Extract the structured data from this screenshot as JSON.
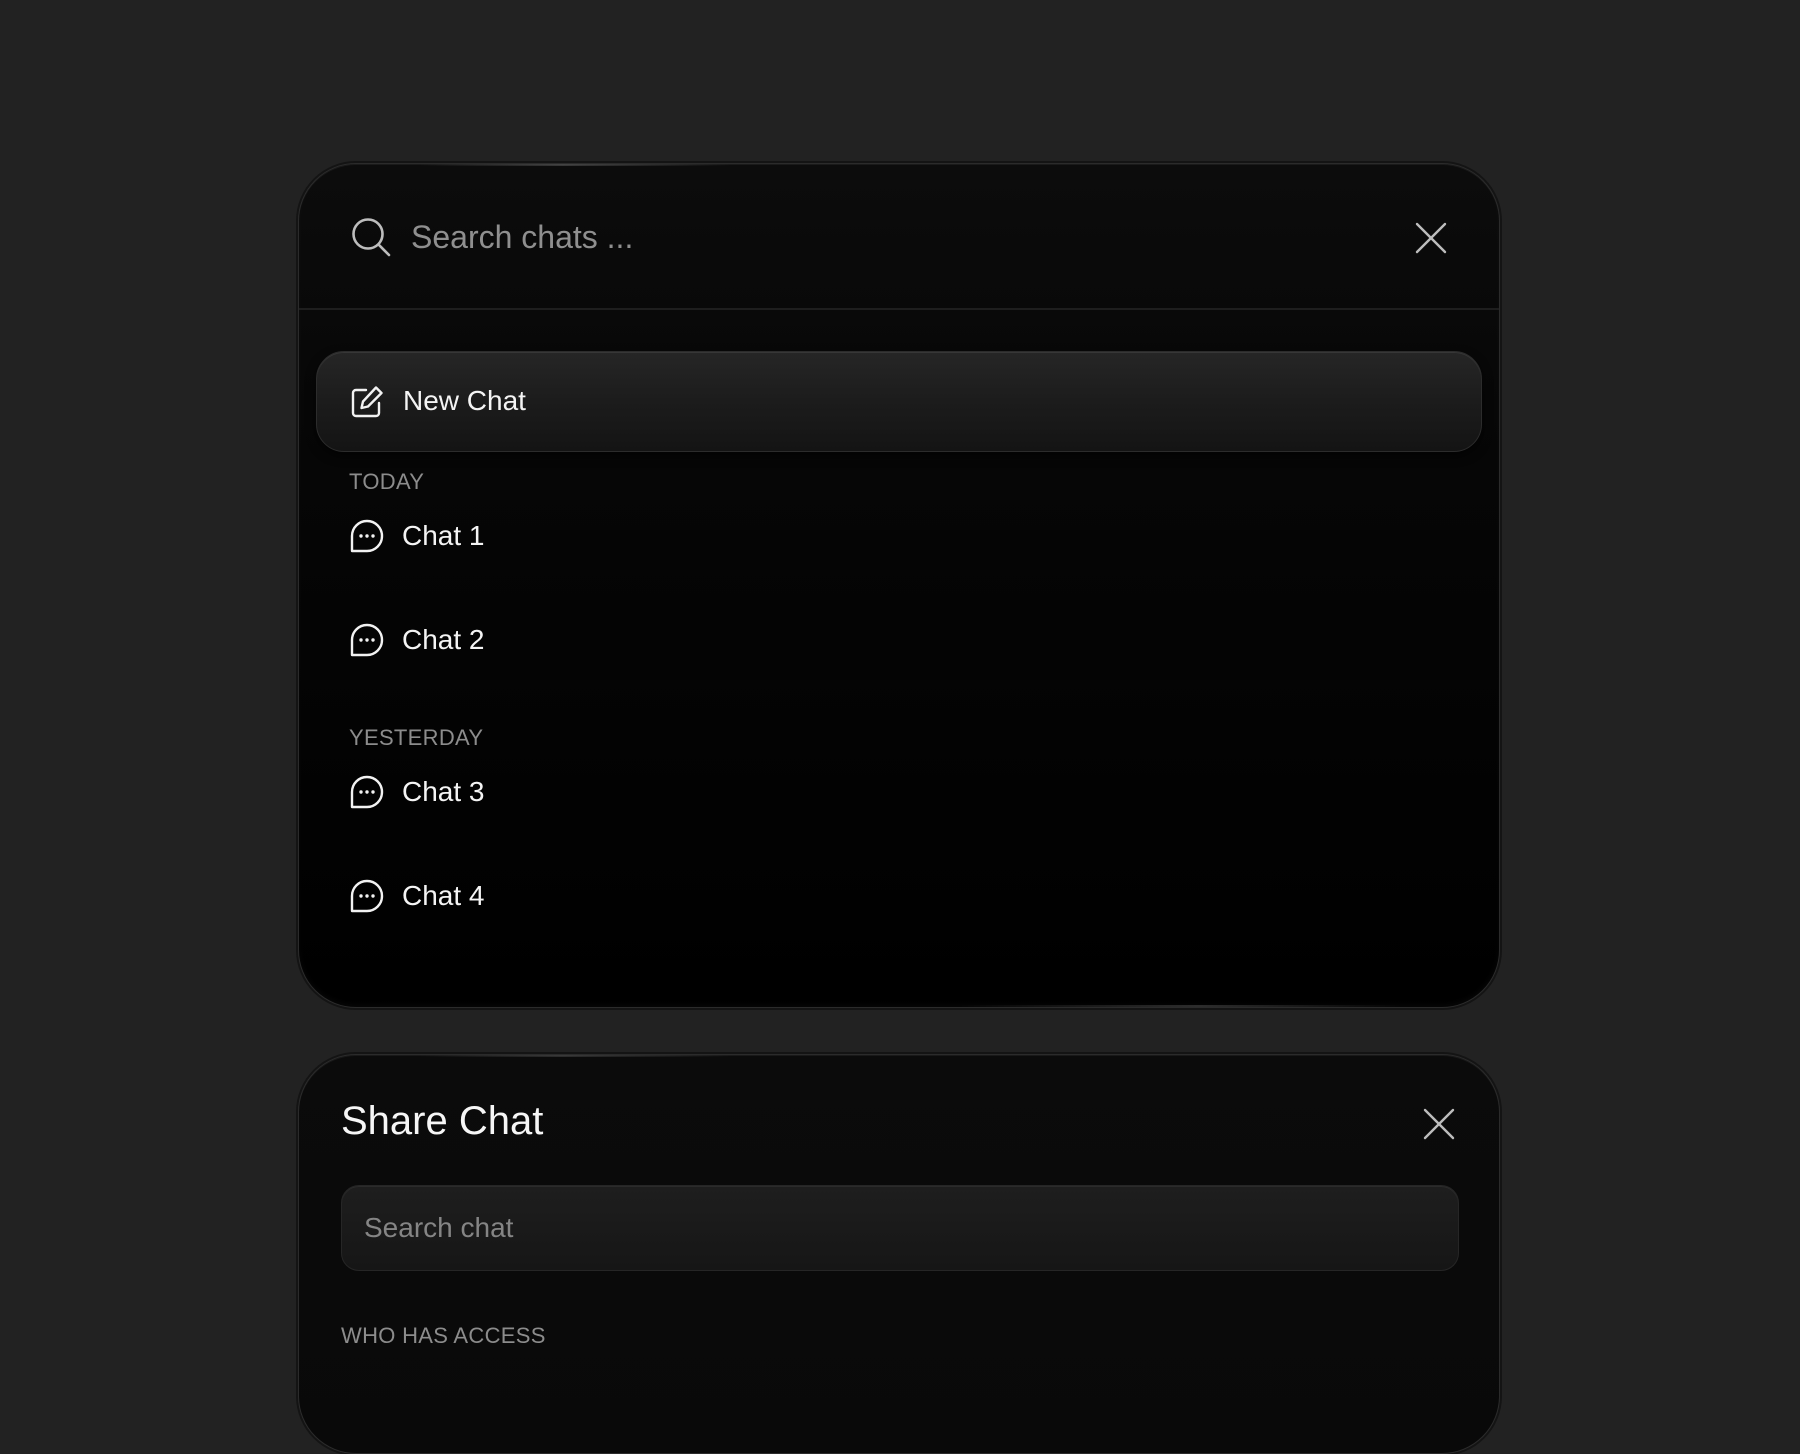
{
  "search_panel": {
    "search_placeholder": "Search chats ...",
    "new_chat_label": "New Chat",
    "sections": [
      {
        "heading": "TODAY",
        "chats": [
          "Chat 1",
          "Chat 2"
        ]
      },
      {
        "heading": "YESTERDAY",
        "chats": [
          "Chat 3",
          "Chat 4"
        ]
      }
    ]
  },
  "share_panel": {
    "title": "Share Chat",
    "search_placeholder": "Search chat",
    "access_heading": "WHO HAS ACCESS"
  },
  "colors": {
    "page_background": "#222222",
    "panel_background": "#000000",
    "text_primary": "#f4f4f4",
    "text_muted": "#8c8c8c"
  }
}
